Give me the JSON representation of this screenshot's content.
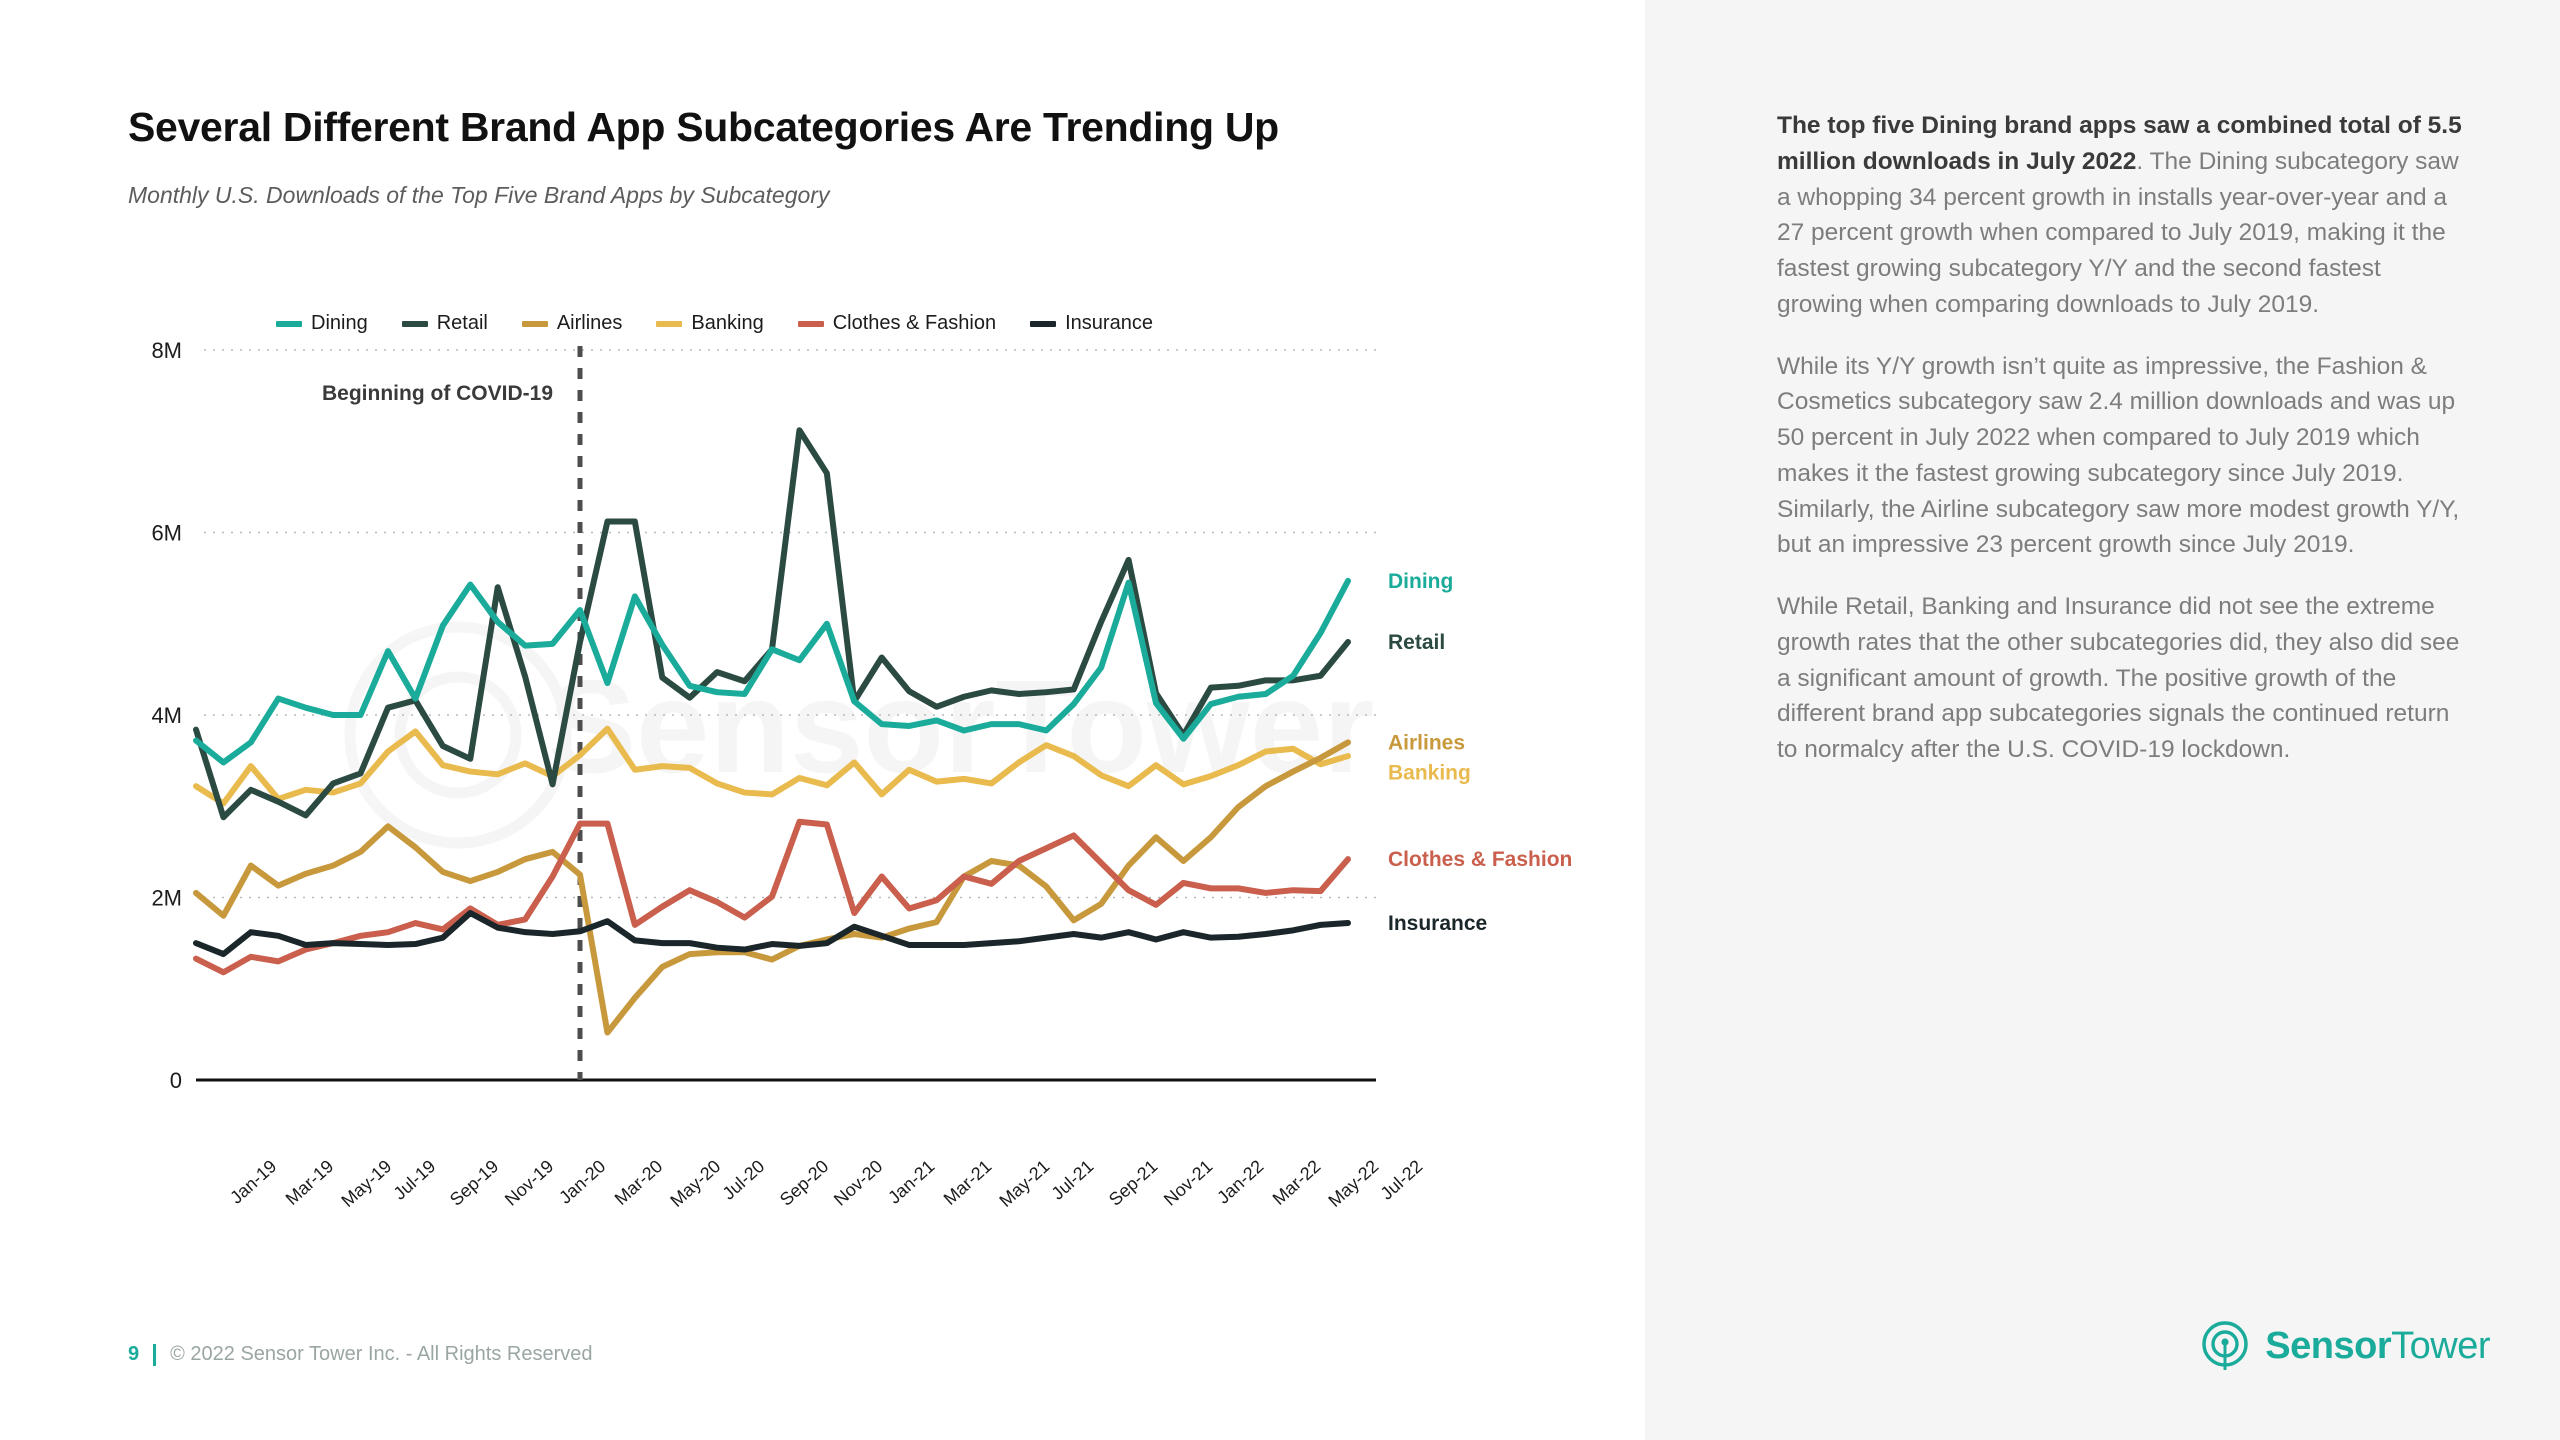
{
  "header": {
    "title": "Several Different Brand App Subcategories Are Trending Up",
    "subtitle": "Monthly U.S. Downloads of the Top Five Brand Apps by Subcategory"
  },
  "annotation": {
    "covid_label": "Beginning of COVID-19",
    "covid_at": "Mar-20"
  },
  "footer": {
    "page_number": "9",
    "copyright": "© 2022 Sensor Tower Inc. - All Rights Reserved"
  },
  "logo": {
    "brand_bold": "Sensor",
    "brand_light": "Tower",
    "icon": "sensor-tower-signal-icon"
  },
  "watermark": "SensorTower",
  "colors": {
    "dining": "#1aab9b",
    "retail": "#2b4a42",
    "airlines": "#c8993c",
    "banking": "#e9ba4d",
    "clothes": "#c95f4c",
    "insurance": "#1b262b",
    "accent": "#1aab9b",
    "panel_bg": "#f5f5f5",
    "grid": "#b9b9b9"
  },
  "sidebar_text": {
    "paragraphs": [
      {
        "lead": "The top five Dining brand apps saw a combined total of 5.5 million downloads in July 2022",
        "rest": ". The Dining subcategory saw a whopping 34 percent growth in installs year-over-year and a 27 percent growth when compared to July 2019, making it the fastest growing subcategory Y/Y and the second fastest growing when comparing downloads to July 2019."
      },
      {
        "lead": "",
        "rest": "While its Y/Y growth isn’t quite as impressive, the Fashion & Cosmetics subcategory saw 2.4 million downloads and was up 50 percent in July 2022 when compared to July 2019 which makes it the fastest growing subcategory since July 2019. Similarly, the Airline subcategory saw more modest growth Y/Y, but an impressive 23 percent growth since July 2019."
      },
      {
        "lead": "",
        "rest": "While Retail, Banking and Insurance did not see the extreme growth rates that the other subcategories did, they also did see a significant amount of growth. The positive growth of the different brand app subcategories signals the continued return to normalcy after the U.S. COVID-19 lockdown."
      }
    ]
  },
  "chart_data": {
    "type": "line",
    "title": "Several Different Brand App Subcategories Are Trending Up",
    "subtitle": "Monthly U.S. Downloads of the Top Five Brand Apps by Subcategory",
    "xlabel": "",
    "ylabel": "",
    "ylim": [
      0,
      8000000
    ],
    "yticks": [
      0,
      2000000,
      4000000,
      6000000,
      8000000
    ],
    "ytick_labels": [
      "0",
      "2M",
      "4M",
      "6M",
      "8M"
    ],
    "grid": true,
    "legend_position": "top",
    "x": [
      "Jan-19",
      "Feb-19",
      "Mar-19",
      "Apr-19",
      "May-19",
      "Jun-19",
      "Jul-19",
      "Aug-19",
      "Sep-19",
      "Oct-19",
      "Nov-19",
      "Dec-19",
      "Jan-20",
      "Feb-20",
      "Mar-20",
      "Apr-20",
      "May-20",
      "Jun-20",
      "Jul-20",
      "Aug-20",
      "Sep-20",
      "Oct-20",
      "Nov-20",
      "Dec-20",
      "Jan-21",
      "Feb-21",
      "Mar-21",
      "Apr-21",
      "May-21",
      "Jun-21",
      "Jul-21",
      "Aug-21",
      "Sep-21",
      "Oct-21",
      "Nov-21",
      "Dec-21",
      "Jan-22",
      "Feb-22",
      "Mar-22",
      "Apr-22",
      "May-22",
      "Jun-22",
      "Jul-22"
    ],
    "xtick_labels": [
      "Jan-19",
      "Mar-19",
      "May-19",
      "Jul-19",
      "Sep-19",
      "Nov-19",
      "Jan-20",
      "Mar-20",
      "May-20",
      "Jul-20",
      "Sep-20",
      "Nov-20",
      "Jan-21",
      "Mar-21",
      "May-21",
      "Jul-21",
      "Sep-21",
      "Nov-21",
      "Jan-22",
      "Mar-22",
      "May-22",
      "Jul-22"
    ],
    "series": [
      {
        "name": "Dining",
        "color": "#1aab9b",
        "end_label": "Dining",
        "values": [
          3720000,
          3480000,
          3700000,
          4180000,
          4080000,
          4000000,
          4000000,
          4700000,
          4180000,
          4980000,
          5430000,
          5020000,
          4760000,
          4780000,
          5150000,
          4350000,
          5300000,
          4770000,
          4320000,
          4250000,
          4230000,
          4720000,
          4600000,
          5000000,
          4150000,
          3900000,
          3880000,
          3940000,
          3830000,
          3900000,
          3900000,
          3830000,
          4120000,
          4520000,
          5450000,
          4130000,
          3740000,
          4120000,
          4200000,
          4230000,
          4430000,
          4900000,
          5470000
        ]
      },
      {
        "name": "Retail",
        "color": "#2b4a42",
        "end_label": "Retail",
        "values": [
          3840000,
          2880000,
          3180000,
          3050000,
          2900000,
          3250000,
          3360000,
          4080000,
          4160000,
          3660000,
          3520000,
          5400000,
          4420000,
          3240000,
          4800000,
          6120000,
          6120000,
          4410000,
          4190000,
          4470000,
          4370000,
          4720000,
          7120000,
          6650000,
          4150000,
          4630000,
          4260000,
          4090000,
          4200000,
          4270000,
          4230000,
          4250000,
          4280000,
          5020000,
          5700000,
          4240000,
          3780000,
          4300000,
          4320000,
          4380000,
          4380000,
          4430000,
          4800000
        ]
      },
      {
        "name": "Airlines",
        "color": "#c8993c",
        "end_label": "Airlines",
        "values": [
          2050000,
          1800000,
          2350000,
          2130000,
          2260000,
          2350000,
          2500000,
          2780000,
          2550000,
          2280000,
          2180000,
          2280000,
          2420000,
          2500000,
          2250000,
          520000,
          900000,
          1240000,
          1380000,
          1400000,
          1400000,
          1320000,
          1470000,
          1540000,
          1600000,
          1560000,
          1660000,
          1730000,
          2230000,
          2400000,
          2350000,
          2120000,
          1750000,
          1930000,
          2350000,
          2660000,
          2400000,
          2660000,
          2990000,
          3220000,
          3380000,
          3530000,
          3700000
        ]
      },
      {
        "name": "Banking",
        "color": "#e9ba4d",
        "end_label": "Banking",
        "values": [
          3220000,
          3030000,
          3440000,
          3080000,
          3180000,
          3150000,
          3250000,
          3600000,
          3820000,
          3450000,
          3380000,
          3350000,
          3470000,
          3330000,
          3560000,
          3850000,
          3400000,
          3440000,
          3420000,
          3250000,
          3150000,
          3130000,
          3310000,
          3230000,
          3480000,
          3130000,
          3400000,
          3270000,
          3300000,
          3250000,
          3480000,
          3670000,
          3550000,
          3340000,
          3220000,
          3450000,
          3240000,
          3330000,
          3450000,
          3600000,
          3630000,
          3460000,
          3550000
        ]
      },
      {
        "name": "Clothes & Fashion",
        "color": "#c95f4c",
        "end_label": "Clothes & Fashion",
        "values": [
          1330000,
          1180000,
          1350000,
          1300000,
          1430000,
          1500000,
          1580000,
          1620000,
          1720000,
          1650000,
          1880000,
          1700000,
          1760000,
          2230000,
          2810000,
          2810000,
          1700000,
          1900000,
          2080000,
          1950000,
          1780000,
          2010000,
          2830000,
          2800000,
          1830000,
          2230000,
          1880000,
          1970000,
          2230000,
          2150000,
          2400000,
          2540000,
          2680000,
          2380000,
          2080000,
          1920000,
          2160000,
          2100000,
          2100000,
          2050000,
          2080000,
          2070000,
          2420000
        ]
      },
      {
        "name": "Insurance",
        "color": "#1b262b",
        "end_label": "Insurance",
        "values": [
          1500000,
          1380000,
          1620000,
          1580000,
          1480000,
          1500000,
          1490000,
          1480000,
          1490000,
          1560000,
          1830000,
          1670000,
          1620000,
          1600000,
          1630000,
          1740000,
          1530000,
          1500000,
          1500000,
          1450000,
          1430000,
          1490000,
          1470000,
          1500000,
          1680000,
          1580000,
          1480000,
          1480000,
          1480000,
          1500000,
          1520000,
          1560000,
          1600000,
          1560000,
          1620000,
          1540000,
          1620000,
          1560000,
          1570000,
          1600000,
          1640000,
          1700000,
          1720000
        ]
      }
    ]
  }
}
